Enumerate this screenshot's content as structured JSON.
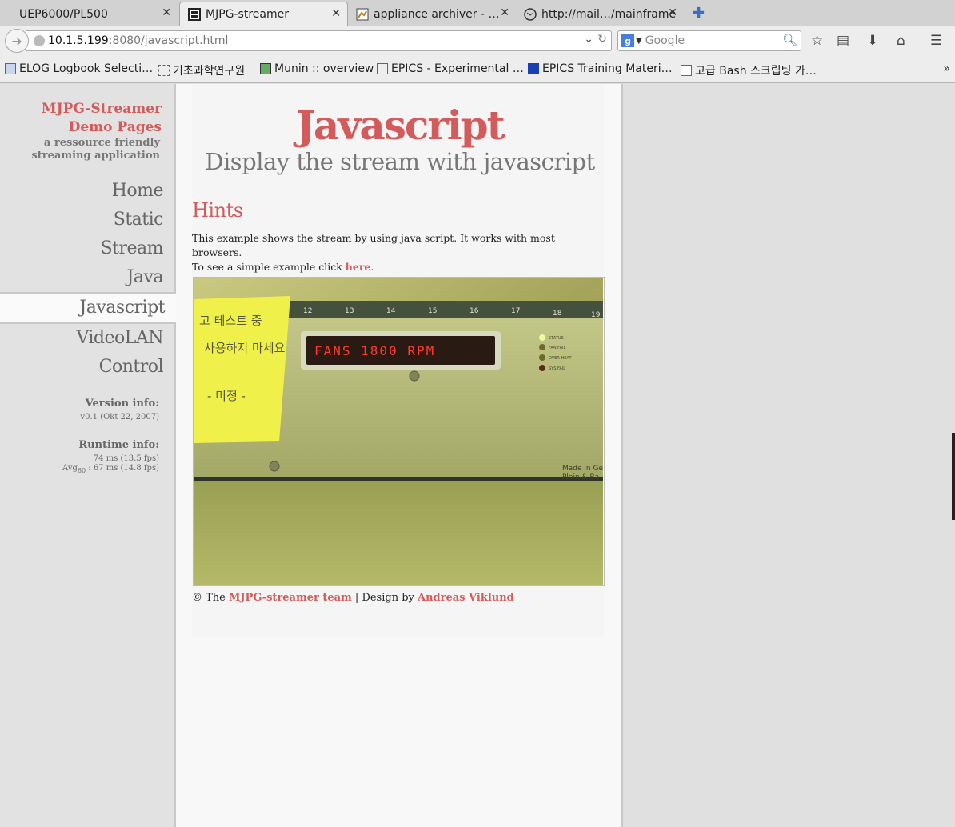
{
  "tabs": [
    {
      "title": "UEP6000/PL500",
      "active": false
    },
    {
      "title": "MJPG-streamer",
      "active": true
    },
    {
      "title": "appliance archiver - …",
      "active": false
    },
    {
      "title": "http://mail…/mainframe",
      "active": false
    }
  ],
  "url": {
    "host": "10.1.5.199",
    "path": ":8080/javascript.html"
  },
  "search": {
    "placeholder": "Google",
    "engine_icon": "google-icon"
  },
  "bookmarks": [
    "ELOG Logbook Selecti…",
    "기초과학연구원",
    "Munin :: overview",
    "EPICS - Experimental …",
    "EPICS Training Materi…",
    "고급 Bash 스크립팅 가…"
  ],
  "sidebar": {
    "brand_title_1": "MJPG-Streamer",
    "brand_title_2": "Demo Pages",
    "brand_sub_1": "a ressource friendly",
    "brand_sub_2": "streaming application",
    "menu": [
      "Home",
      "Static",
      "Stream",
      "Java",
      "Javascript",
      "VideoLAN",
      "Control"
    ],
    "active_index": 4,
    "version_head": "Version info:",
    "version_value": "v0.1 (Okt 22, 2007)",
    "runtime_head": "Runtime info:",
    "runtime_line1": "74 ms (13.5 fps)",
    "runtime_avg_label": "Avg",
    "runtime_avg_sub": "60",
    "runtime_avg_value": ": 67 ms (14.8 fps)"
  },
  "main": {
    "title": "Javascript",
    "subtitle": "Display the stream with javascript",
    "section": "Hints",
    "para_1": "This example shows the stream by using java script. It works with most browsers.",
    "para_2a": "To see a simple example click ",
    "para_2_link": "here",
    "para_2b": ".",
    "stream_numbers": [
      "12",
      "13",
      "14",
      "15",
      "16",
      "17",
      "18",
      "19"
    ],
    "stream_display": "FANS 1800 RPM",
    "stream_leds": [
      "STATUS",
      "FAN FAIL",
      "OVER HEAT",
      "SYS FAIL"
    ],
    "stream_note": [
      "고 테스트 중",
      "사용하지 마세요",
      "- 미정 -"
    ],
    "stream_made_1": "Made in Ge",
    "stream_made_2": "Plein & Ba",
    "footer_pre": "© The ",
    "footer_link1": "MJPG-streamer team",
    "footer_mid": " | Design by ",
    "footer_link2": "Andreas Viklund"
  }
}
